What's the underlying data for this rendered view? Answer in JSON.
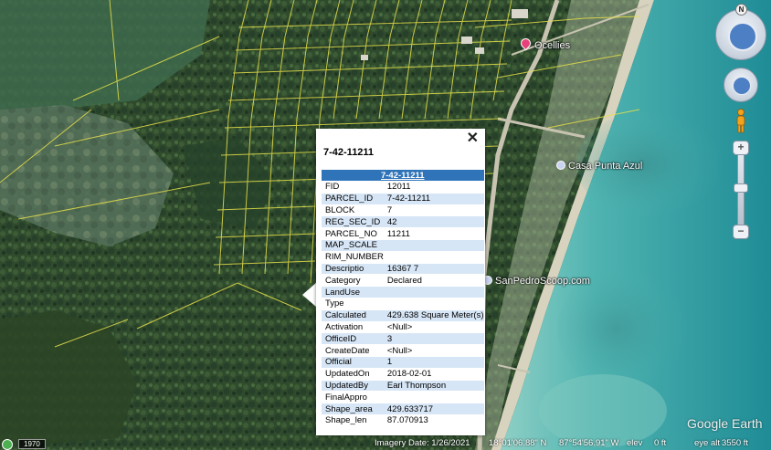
{
  "places": {
    "ocellies": "Ocellies",
    "casa_punta_azul": "Casa Punta Azul",
    "san_pedro_scoop": "SanPedroScoop.com"
  },
  "balloon": {
    "title": "7-42-11211",
    "header": "7-42-11211",
    "close": "✕",
    "rows": [
      {
        "key": "FID",
        "value": "12011"
      },
      {
        "key": "PARCEL_ID",
        "value": "7-42-11211"
      },
      {
        "key": "BLOCK",
        "value": "7"
      },
      {
        "key": "REG_SEC_ID",
        "value": "42"
      },
      {
        "key": "PARCEL_NO",
        "value": "11211"
      },
      {
        "key": "MAP_SCALE",
        "value": ""
      },
      {
        "key": "RIM_NUMBER",
        "value": ""
      },
      {
        "key": "Descriptio",
        "value": "16367 7"
      },
      {
        "key": "Category",
        "value": "Declared"
      },
      {
        "key": "LandUse",
        "value": ""
      },
      {
        "key": "Type",
        "value": ""
      },
      {
        "key": "Calculated",
        "value": "429.638 Square Meter(s)"
      },
      {
        "key": "Activation",
        "value": "<Null>"
      },
      {
        "key": "OfficeID",
        "value": "3"
      },
      {
        "key": "CreateDate",
        "value": "<Null>"
      },
      {
        "key": "Official",
        "value": "1"
      },
      {
        "key": "UpdatedOn",
        "value": "2018-02-01"
      },
      {
        "key": "UpdatedBy",
        "value": "Earl Thompson"
      },
      {
        "key": "FinalAppro",
        "value": ""
      },
      {
        "key": "Shape_area",
        "value": "429.633717"
      },
      {
        "key": "Shape_len",
        "value": "87.070913"
      }
    ]
  },
  "controls": {
    "north": "N",
    "zoom_in": "+",
    "zoom_out": "−"
  },
  "status": {
    "year": "1970",
    "imagery_date": "Imagery Date: 1/26/2021",
    "lat": "18°01'06.88\" N",
    "lon": "87°54'56.91\" W",
    "elev": "elev",
    "elev_value": "0 ft",
    "eye_alt": "eye alt",
    "eye_alt_value": "3550 ft"
  },
  "logo": "Google Earth",
  "colors": {
    "parcel_lines": "#e6e04a",
    "header_blue": "#2f74b8",
    "alt_row": "#d7e6f6",
    "sea": "#5fb6b0",
    "vegetation": "#2f4a2a"
  }
}
